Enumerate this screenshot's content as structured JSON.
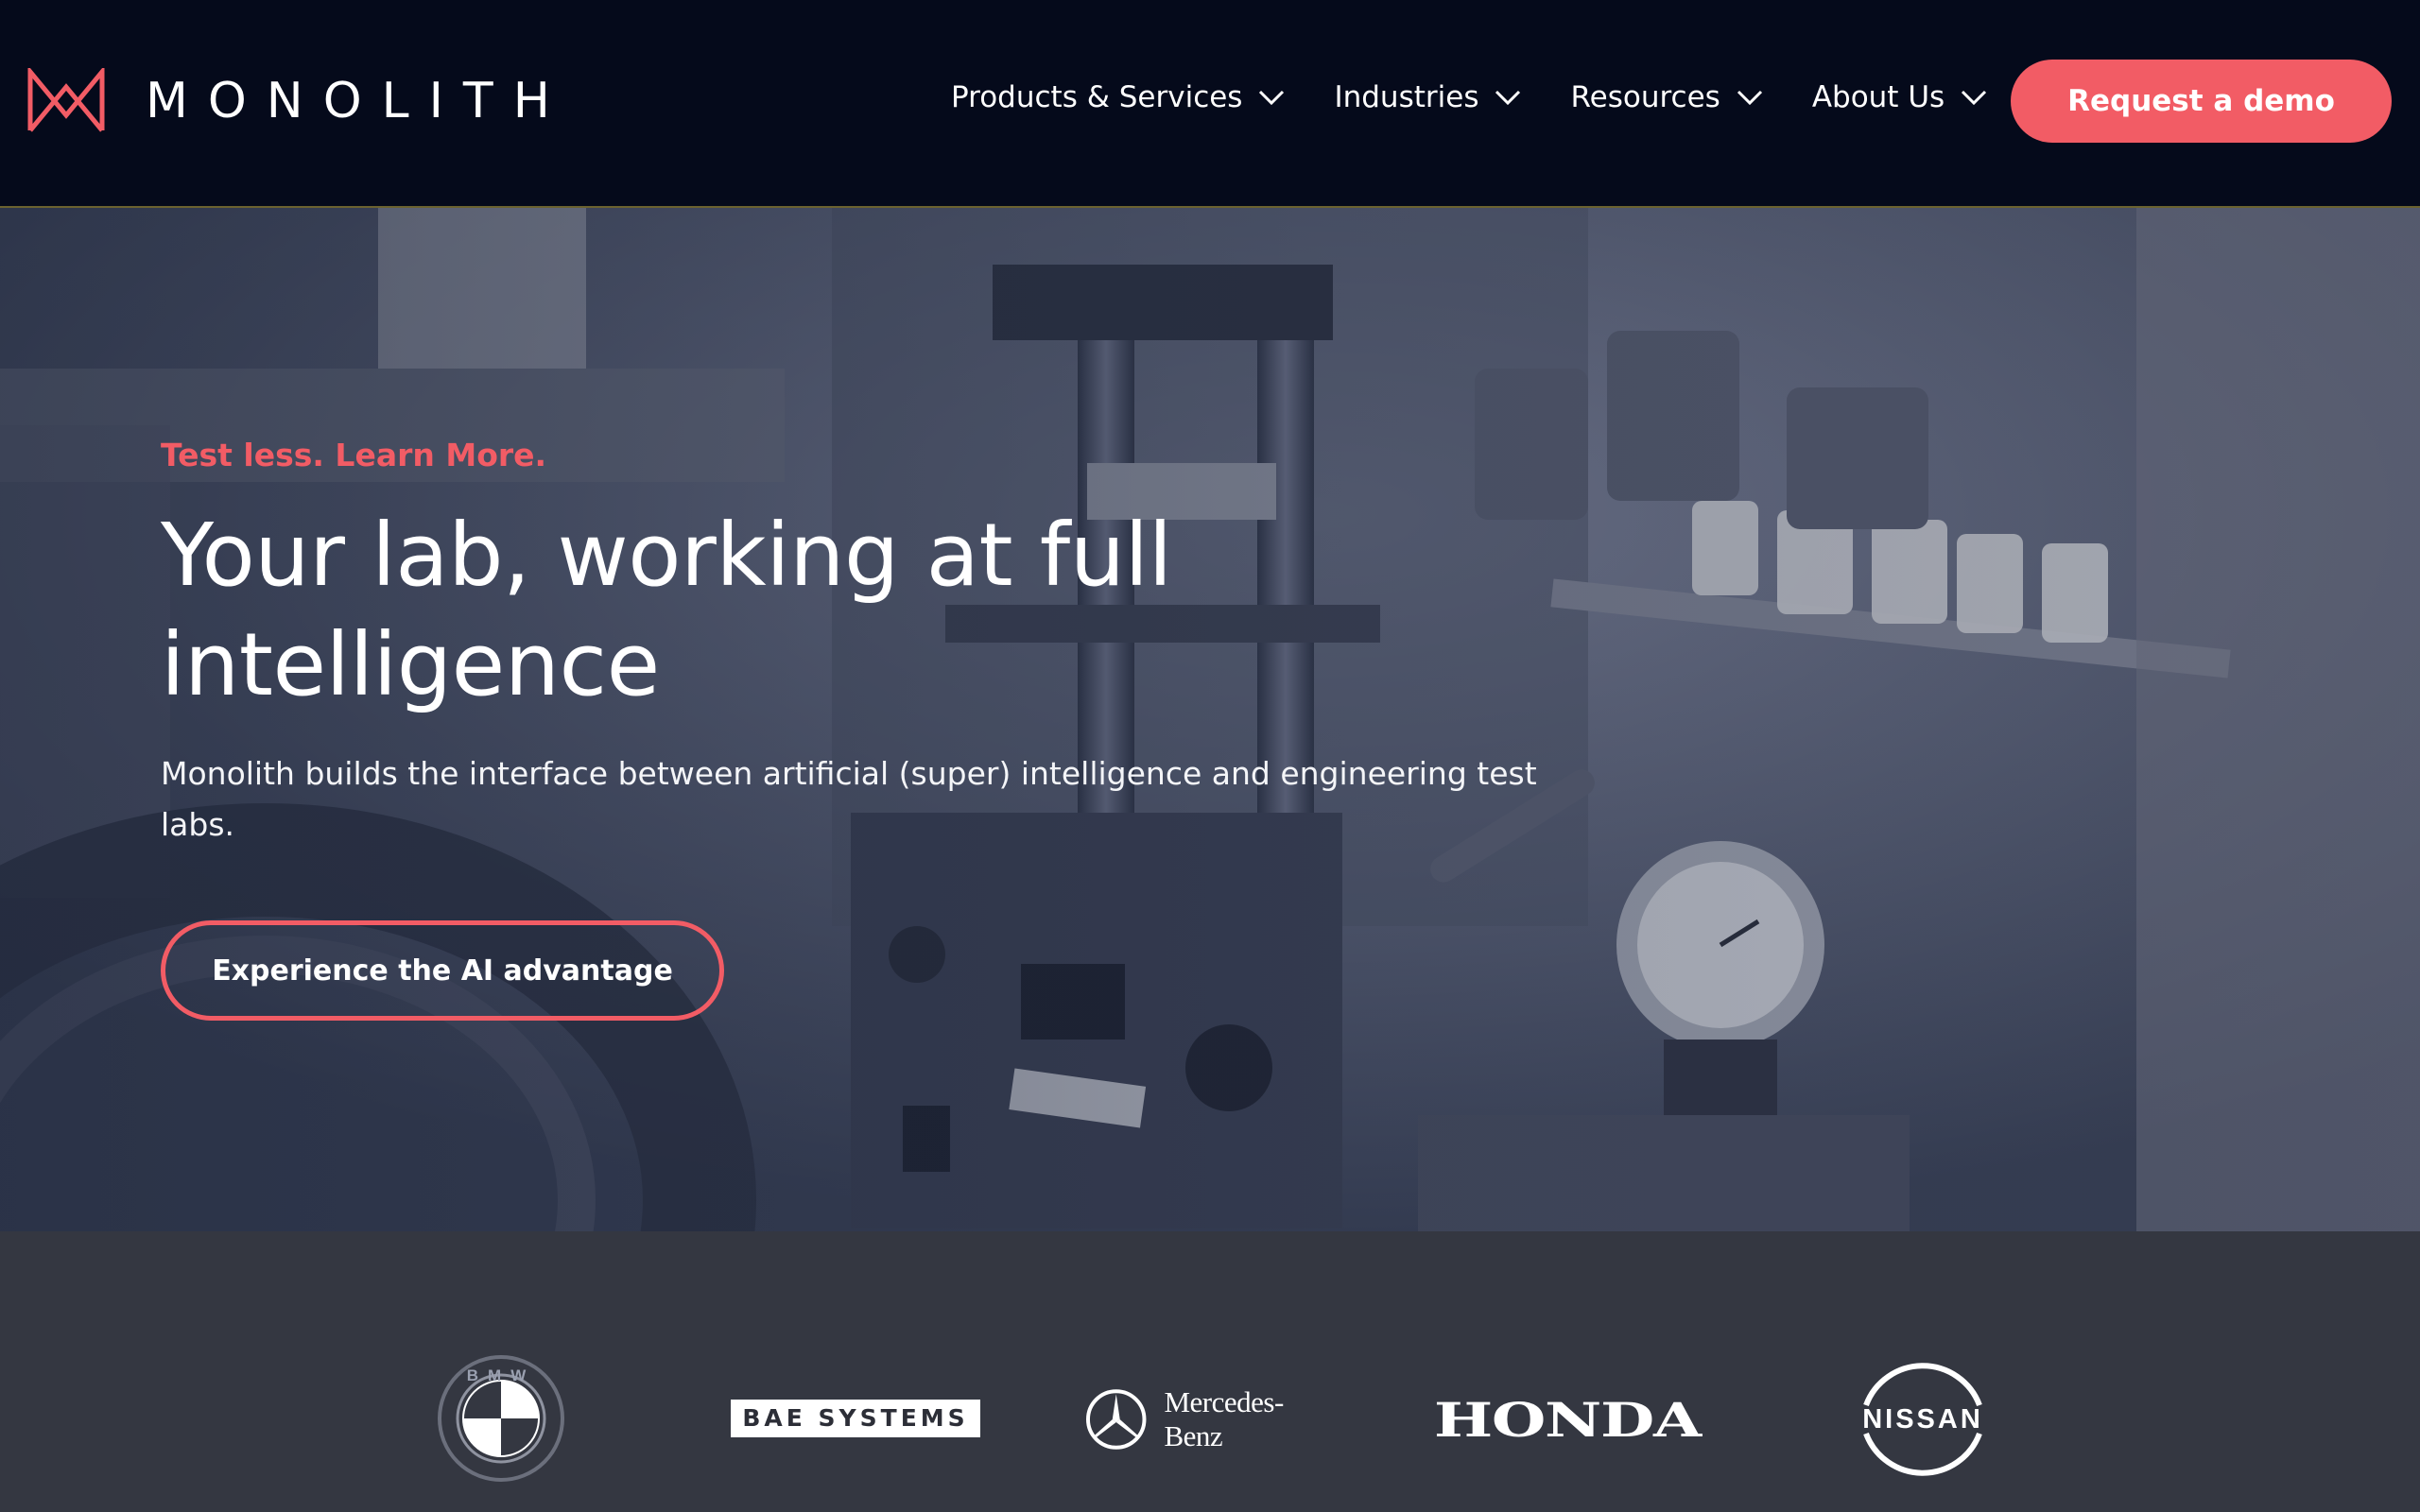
{
  "header": {
    "brand_name": "MONOLITH",
    "nav": [
      {
        "label": "Products & Services"
      },
      {
        "label": "Industries"
      },
      {
        "label": "Resources"
      },
      {
        "label": "About Us"
      }
    ],
    "cta_label": "Request a demo"
  },
  "hero": {
    "eyebrow": "Test less. Learn More.",
    "title": "Your lab, working at full intelligence",
    "subtitle": "Monolith builds the interface between artificial (super) intelligence and engineering test labs.",
    "cta_label": "Experience the AI advantage"
  },
  "logos": {
    "bmw": "BMW",
    "bae": "BAE SYSTEMS",
    "mercedes": "Mercedes-Benz",
    "honda": "HONDA",
    "nissan": "NISSAN"
  },
  "colors": {
    "accent": "#f25c65",
    "header_bg": "#050a1b",
    "logos_bg": "#343741"
  }
}
